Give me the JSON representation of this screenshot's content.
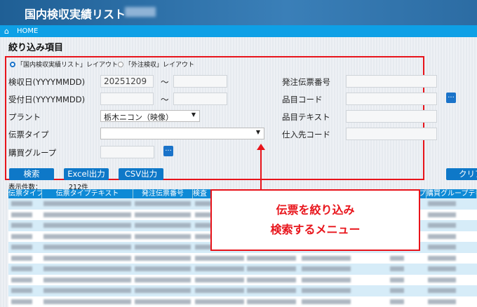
{
  "app": {
    "title": "国内検収実績リスト"
  },
  "nav": {
    "home": "HOME"
  },
  "page": {
    "title": "絞り込み項目"
  },
  "layout_options": [
    {
      "label": "「国内検収実績リスト」レイアウト",
      "selected": true
    },
    {
      "label": "「外注検収」レイアウト",
      "selected": false
    }
  ],
  "filters": {
    "inspection_date": {
      "label": "検収日(YYYYMMDD)",
      "from": "20251209",
      "to": "",
      "sep": "～"
    },
    "receipt_date": {
      "label": "受付日(YYYYMMDD)",
      "from": "",
      "to": "",
      "sep": "～"
    },
    "plant": {
      "label": "プラント",
      "value": "栃木ニコン（映像）"
    },
    "slip_type": {
      "label": "伝票タイプ",
      "value": ""
    },
    "purchasing_group": {
      "label": "購買グループ",
      "value": ""
    },
    "po_number": {
      "label": "発注伝票番号",
      "value": ""
    },
    "item_code": {
      "label": "品目コード",
      "value": ""
    },
    "item_text": {
      "label": "品目テキスト",
      "value": ""
    },
    "supplier_code": {
      "label": "仕入先コード",
      "value": ""
    },
    "lookup": "..."
  },
  "buttons": {
    "search": "検索",
    "excel": "Excel出力",
    "csv": "CSV出力",
    "clear": "クリア"
  },
  "result": {
    "count_label": "表示件数：",
    "count": "212件"
  },
  "table": {
    "columns": [
      "伝票タイプ",
      "伝票タイプテキスト",
      "発注伝票番号",
      "検査",
      "プ",
      "購買グループテキスト"
    ]
  },
  "callout": {
    "line1": "伝票を絞り込み",
    "line2": "検索するメニュー"
  },
  "colors": {
    "header": "#1f5f95",
    "nav": "#0ea0e6",
    "accent": "#0e78c8",
    "highlight": "#e8141b"
  }
}
